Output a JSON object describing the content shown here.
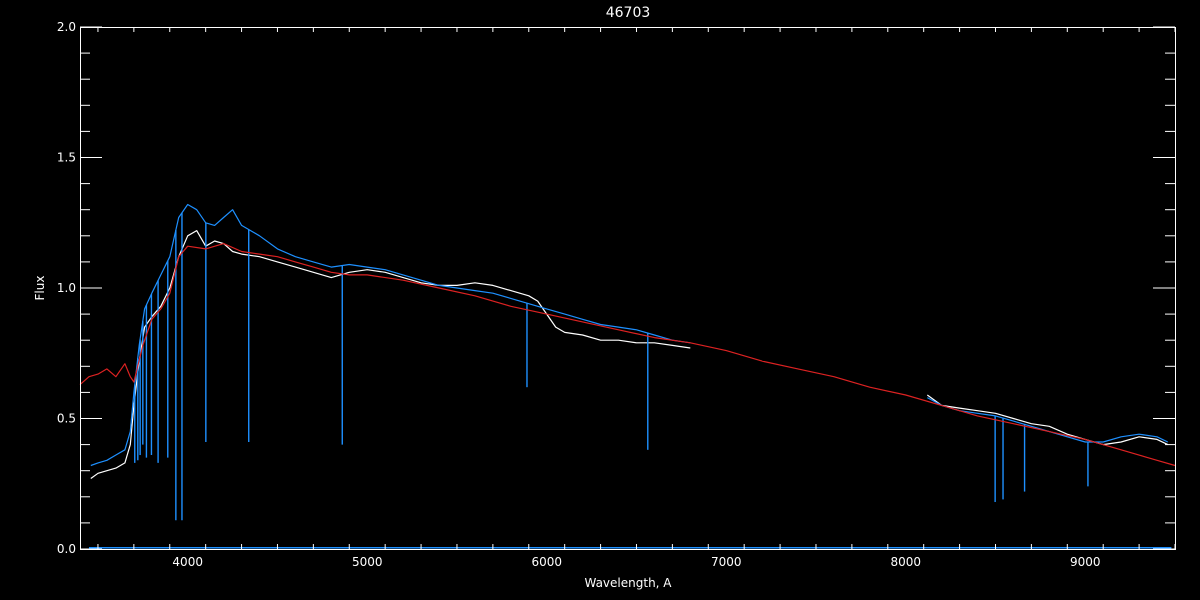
{
  "chart_data": {
    "type": "line",
    "title": "46703",
    "xlabel": "Wavelength, A",
    "ylabel": "Flux",
    "xlim": [
      3400,
      9500
    ],
    "ylim": [
      0.0,
      2.0
    ],
    "xticks": [
      4000,
      5000,
      6000,
      7000,
      8000,
      9000
    ],
    "xtick_labels": [
      "4000",
      "5000",
      "6000",
      "7000",
      "8000",
      "9000"
    ],
    "yticks": [
      0.0,
      0.5,
      1.0,
      1.5,
      2.0
    ],
    "ytick_labels": [
      "0.0",
      "0.5",
      "1.0",
      "1.5",
      "2.0"
    ],
    "grid": false,
    "colors": {
      "background": "#000000",
      "axes": "#ffffff",
      "text": "#ffffff",
      "white_spectrum": "#ffffff",
      "blue_spectrum": "#1e90ff",
      "model": "#dd2222"
    },
    "series": [
      {
        "color": "white",
        "segments": [
          {
            "x": [
              3460,
              3500,
              3550,
              3600,
              3650,
              3680,
              3700,
              3730,
              3760,
              3800,
              3850,
              3900,
              3950,
              4000,
              4050,
              4100,
              4150,
              4200,
              4250,
              4300,
              4400,
              4500,
              4600,
              4700,
              4800,
              4900,
              5000,
              5100,
              5200,
              5300,
              5400,
              5500,
              5600,
              5700,
              5800,
              5900,
              5950,
              6000,
              6050,
              6100,
              6200,
              6300,
              6400,
              6500,
              6600,
              6700,
              6800
            ],
            "y": [
              0.27,
              0.29,
              0.3,
              0.31,
              0.33,
              0.4,
              0.55,
              0.72,
              0.85,
              0.89,
              0.93,
              1.0,
              1.12,
              1.2,
              1.22,
              1.16,
              1.18,
              1.17,
              1.14,
              1.13,
              1.12,
              1.1,
              1.08,
              1.06,
              1.04,
              1.06,
              1.07,
              1.06,
              1.04,
              1.02,
              1.01,
              1.01,
              1.02,
              1.01,
              0.99,
              0.97,
              0.95,
              0.9,
              0.85,
              0.83,
              0.82,
              0.8,
              0.8,
              0.79,
              0.79,
              0.78,
              0.77
            ]
          },
          {
            "x": [
              8120,
              8200,
              8300,
              8400,
              8500,
              8600,
              8700,
              8800,
              8900,
              9000,
              9100,
              9200,
              9300,
              9400,
              9460
            ],
            "y": [
              0.59,
              0.55,
              0.54,
              0.53,
              0.52,
              0.5,
              0.48,
              0.47,
              0.44,
              0.42,
              0.4,
              0.41,
              0.43,
              0.42,
              0.4
            ]
          }
        ]
      },
      {
        "color": "blue",
        "segments": [
          {
            "x": [
              3460,
              3500,
              3550,
              3600,
              3650,
              3680,
              3700,
              3730,
              3760,
              3800,
              3850,
              3900,
              3950,
              4000,
              4050,
              4100,
              4150,
              4200,
              4250,
              4300,
              4400,
              4500,
              4600,
              4700,
              4800,
              4900,
              5000,
              5100,
              5200,
              5300,
              5400,
              5500,
              5600,
              5700,
              5800,
              5900,
              6000,
              6100,
              6200,
              6300,
              6400,
              6500,
              6600,
              6700,
              6800
            ],
            "y": [
              0.32,
              0.33,
              0.34,
              0.36,
              0.38,
              0.45,
              0.6,
              0.78,
              0.92,
              0.98,
              1.05,
              1.12,
              1.27,
              1.32,
              1.3,
              1.25,
              1.24,
              1.27,
              1.3,
              1.24,
              1.2,
              1.15,
              1.12,
              1.1,
              1.08,
              1.09,
              1.08,
              1.07,
              1.05,
              1.03,
              1.01,
              1.0,
              0.99,
              0.98,
              0.96,
              0.94,
              0.92,
              0.9,
              0.88,
              0.86,
              0.85,
              0.84,
              0.82,
              0.8,
              0.79
            ]
          },
          {
            "x": [
              8120,
              8200,
              8300,
              8400,
              8500,
              8600,
              8700,
              8800,
              8900,
              9000,
              9100,
              9200,
              9300,
              9400,
              9460
            ],
            "y": [
              0.58,
              0.55,
              0.53,
              0.52,
              0.51,
              0.49,
              0.47,
              0.45,
              0.43,
              0.41,
              0.41,
              0.43,
              0.44,
              0.43,
              0.41
            ]
          }
        ],
        "absorption_lines": [
          {
            "x": 3705,
            "y": 0.33
          },
          {
            "x": 3722,
            "y": 0.34
          },
          {
            "x": 3735,
            "y": 0.36
          },
          {
            "x": 3750,
            "y": 0.4
          },
          {
            "x": 3770,
            "y": 0.35
          },
          {
            "x": 3798,
            "y": 0.36
          },
          {
            "x": 3835,
            "y": 0.33
          },
          {
            "x": 3889,
            "y": 0.35
          },
          {
            "x": 3934,
            "y": 0.11
          },
          {
            "x": 3968,
            "y": 0.11
          },
          {
            "x": 4101,
            "y": 0.41
          },
          {
            "x": 4340,
            "y": 0.41
          },
          {
            "x": 4861,
            "y": 0.4
          },
          {
            "x": 5890,
            "y": 0.62
          },
          {
            "x": 6563,
            "y": 0.38
          },
          {
            "x": 8498,
            "y": 0.18
          },
          {
            "x": 8542,
            "y": 0.19
          },
          {
            "x": 8662,
            "y": 0.22
          },
          {
            "x": 9015,
            "y": 0.24
          }
        ]
      },
      {
        "color": "red",
        "segments": [
          {
            "x": [
              3400,
              3450,
              3500,
              3550,
              3600,
              3650,
              3680,
              3700,
              3750,
              3800,
              3850,
              3900,
              3950,
              4000,
              4100,
              4200,
              4300,
              4400,
              4500,
              4600,
              4700,
              4800,
              4900,
              5000,
              5200,
              5400,
              5600,
              5800,
              6000,
              6200,
              6400,
              6600,
              6800,
              7000,
              7200,
              7400,
              7600,
              7800,
              8000,
              8200,
              8400,
              8600,
              8800,
              9000,
              9200,
              9400,
              9500
            ],
            "y": [
              0.63,
              0.66,
              0.67,
              0.69,
              0.66,
              0.71,
              0.66,
              0.64,
              0.78,
              0.88,
              0.92,
              0.98,
              1.12,
              1.16,
              1.15,
              1.17,
              1.14,
              1.13,
              1.12,
              1.1,
              1.08,
              1.06,
              1.05,
              1.05,
              1.03,
              1.0,
              0.97,
              0.93,
              0.9,
              0.87,
              0.84,
              0.81,
              0.79,
              0.76,
              0.72,
              0.69,
              0.66,
              0.62,
              0.59,
              0.55,
              0.51,
              0.48,
              0.45,
              0.42,
              0.38,
              0.34,
              0.32
            ]
          }
        ]
      }
    ]
  }
}
